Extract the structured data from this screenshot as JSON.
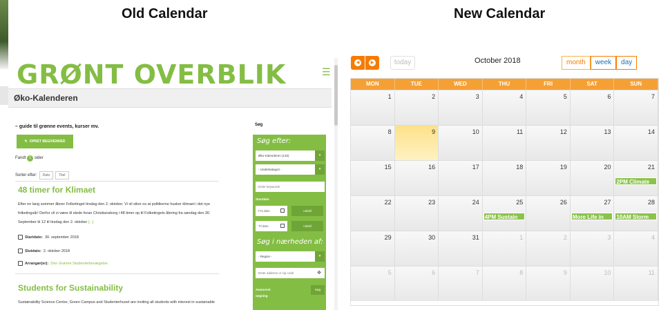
{
  "headings": {
    "old": "Old Calendar",
    "new": "New Calendar"
  },
  "old": {
    "logo": "GRØNT OVERBLIK",
    "subtitle": "Øko-Kalenderen",
    "tagline": "– guide til grønne events, kurser mv.",
    "create_button": "OPRET BEGIVENHED",
    "found_prefix": "Fandt",
    "found_count": "1",
    "found_suffix": "sider",
    "sort_label": "Sorter efter:",
    "sort_options": [
      "Dato",
      "Titel"
    ],
    "events": [
      {
        "title": "48 timer for Klimaet",
        "body": "Efter en lang sommer åbner Folketinget tirsdag den 2. oktober. Vi vil sikre os at politikerne husker klimaet i det nye folketingsår! Derfor vil vi være til stede foran Christiansborg i 48 timer op til Folketingets åbning fra søndag den 30. September kl 12 til tirsdag den 2. oktober",
        "more": "[...]",
        "start_label": "Startdato:",
        "start": "30. september 2018",
        "end_label": "Slutdato:",
        "end": "2. oktober 2018",
        "org_label": "Arrangør(er):",
        "org": "Den Grønne Studenterbevægelse"
      },
      {
        "title": "Students for Sustainability",
        "body": "Sustainability Science Centre, Green Campus and Studenterhuset are inviting all students with interest in sustainable"
      }
    ],
    "search": {
      "label": "Søg",
      "heading": "Søg efter:",
      "category": "Øko-Kalenderen (133)",
      "subcategory": "- Underkategori -",
      "keywords_placeholder": "Enter keywords",
      "start_label": "Startdato",
      "from_placeholder": "Fra dato",
      "to_placeholder": "Til dato",
      "reset": "nulstil",
      "near_heading": "Søg i nærheden af:",
      "region": "- Region -",
      "address_placeholder": "Enter address or zip code",
      "advanced": "Avanceret søgning",
      "search_button": "Søg"
    }
  },
  "new": {
    "today": "today",
    "title": "October 2018",
    "views": [
      "month",
      "week",
      "day"
    ],
    "active_view": "month",
    "weekdays": [
      "MON",
      "TUE",
      "WED",
      "THU",
      "FRI",
      "SAT",
      "SUN"
    ],
    "weeks": [
      [
        {
          "d": "1"
        },
        {
          "d": "2"
        },
        {
          "d": "3"
        },
        {
          "d": "4"
        },
        {
          "d": "5"
        },
        {
          "d": "6"
        },
        {
          "d": "7"
        }
      ],
      [
        {
          "d": "8"
        },
        {
          "d": "9",
          "today": true
        },
        {
          "d": "10"
        },
        {
          "d": "11"
        },
        {
          "d": "12"
        },
        {
          "d": "13"
        },
        {
          "d": "14"
        }
      ],
      [
        {
          "d": "15"
        },
        {
          "d": "16"
        },
        {
          "d": "17"
        },
        {
          "d": "18"
        },
        {
          "d": "19"
        },
        {
          "d": "20"
        },
        {
          "d": "21",
          "ev": "2PM Climate"
        }
      ],
      [
        {
          "d": "22"
        },
        {
          "d": "23"
        },
        {
          "d": "24"
        },
        {
          "d": "25",
          "ev": "4PM Sustain"
        },
        {
          "d": "26"
        },
        {
          "d": "27",
          "ev": "More Life in"
        },
        {
          "d": "28",
          "ev": "10AM Storm"
        }
      ],
      [
        {
          "d": "29"
        },
        {
          "d": "30"
        },
        {
          "d": "31"
        },
        {
          "d": "1",
          "other": true
        },
        {
          "d": "2",
          "other": true
        },
        {
          "d": "3",
          "other": true
        },
        {
          "d": "4",
          "other": true
        }
      ],
      [
        {
          "d": "5",
          "other": true
        },
        {
          "d": "6",
          "other": true
        },
        {
          "d": "7",
          "other": true
        },
        {
          "d": "8",
          "other": true
        },
        {
          "d": "9",
          "other": true
        },
        {
          "d": "10",
          "other": true
        },
        {
          "d": "11",
          "other": true
        }
      ]
    ]
  }
}
